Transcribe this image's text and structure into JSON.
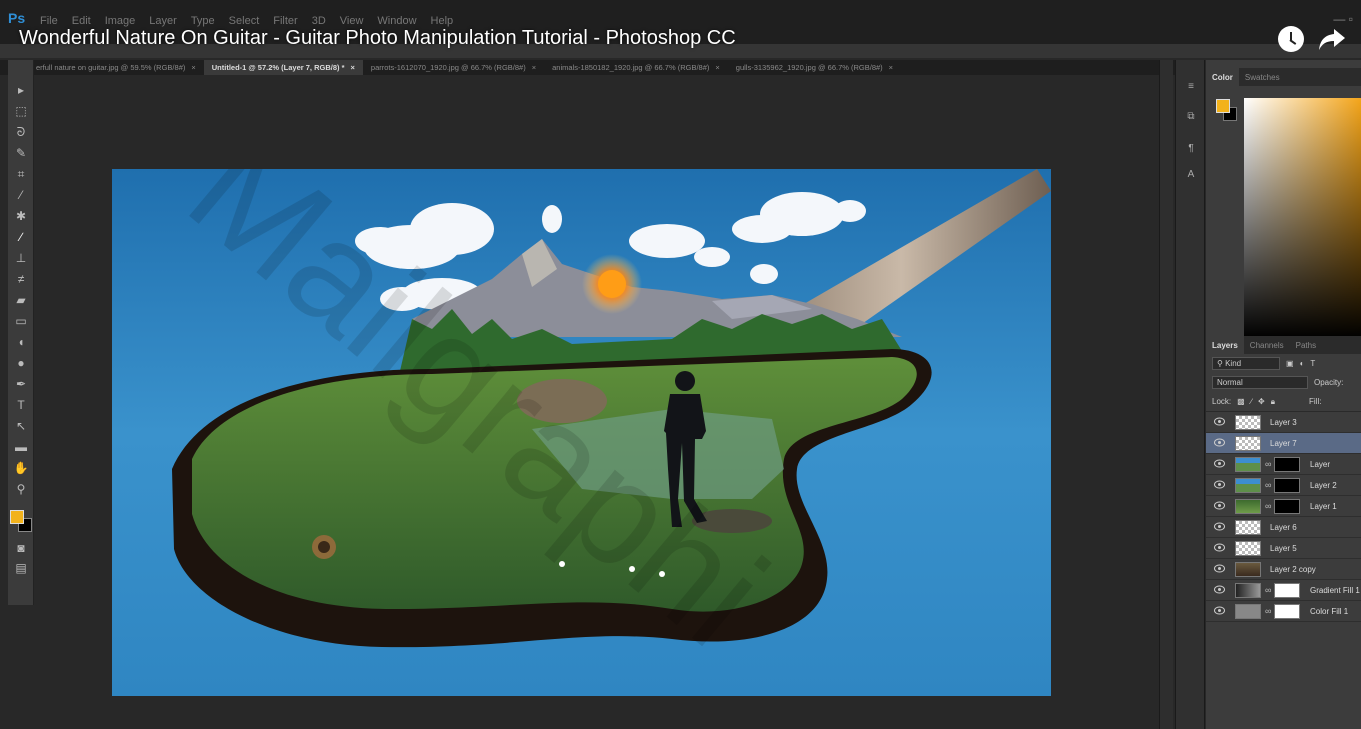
{
  "video": {
    "title": "Wonderful Nature On Guitar - Guitar Photo Manipulation Tutorial - Photoshop CC"
  },
  "menubar": {
    "app_logo": "Ps",
    "items": [
      "File",
      "Edit",
      "Image",
      "Layer",
      "Type",
      "Select",
      "Filter",
      "3D",
      "View",
      "Window",
      "Help"
    ]
  },
  "tabs": [
    {
      "label": "erfull nature on guitar.jpg @ 59.5% (RGB/8#)",
      "active": false
    },
    {
      "label": "Untitled-1 @ 57.2% (Layer 7, RGB/8) *",
      "active": true
    },
    {
      "label": "parrots-1612070_1920.jpg @ 66.7% (RGB/8#)",
      "active": false
    },
    {
      "label": "animals-1850182_1920.jpg @ 66.7% (RGB/8#)",
      "active": false
    },
    {
      "label": "gulls-3135962_1920.jpg @ 66.7% (RGB/8#)",
      "active": false
    }
  ],
  "tab_close": "×",
  "color_panel": {
    "tabs": [
      "Color",
      "Swatches"
    ],
    "foreground": "#f2b21b",
    "background": "#000000"
  },
  "layers_panel": {
    "tabs": [
      "Layers",
      "Channels",
      "Paths"
    ],
    "kind": "Kind",
    "blend_mode": "Normal",
    "opacity_label": "Opacity:",
    "lock_label": "Lock:",
    "fill_label": "Fill:",
    "layers": [
      {
        "name": "Layer 3",
        "selected": false,
        "mask": false
      },
      {
        "name": "Layer 7",
        "selected": true,
        "mask": false
      },
      {
        "name": "Layer",
        "selected": false,
        "mask": true
      },
      {
        "name": "Layer 2",
        "selected": false,
        "mask": true
      },
      {
        "name": "Layer 1",
        "selected": false,
        "mask": true
      },
      {
        "name": "Layer 6",
        "selected": false,
        "mask": false
      },
      {
        "name": "Layer 5",
        "selected": false,
        "mask": false
      },
      {
        "name": "Layer 2 copy",
        "selected": false,
        "mask": false
      },
      {
        "name": "Gradient Fill 1",
        "selected": false,
        "mask": true
      },
      {
        "name": "Color Fill 1",
        "selected": false,
        "mask": true
      }
    ]
  },
  "watermark": "Mailgraphi"
}
